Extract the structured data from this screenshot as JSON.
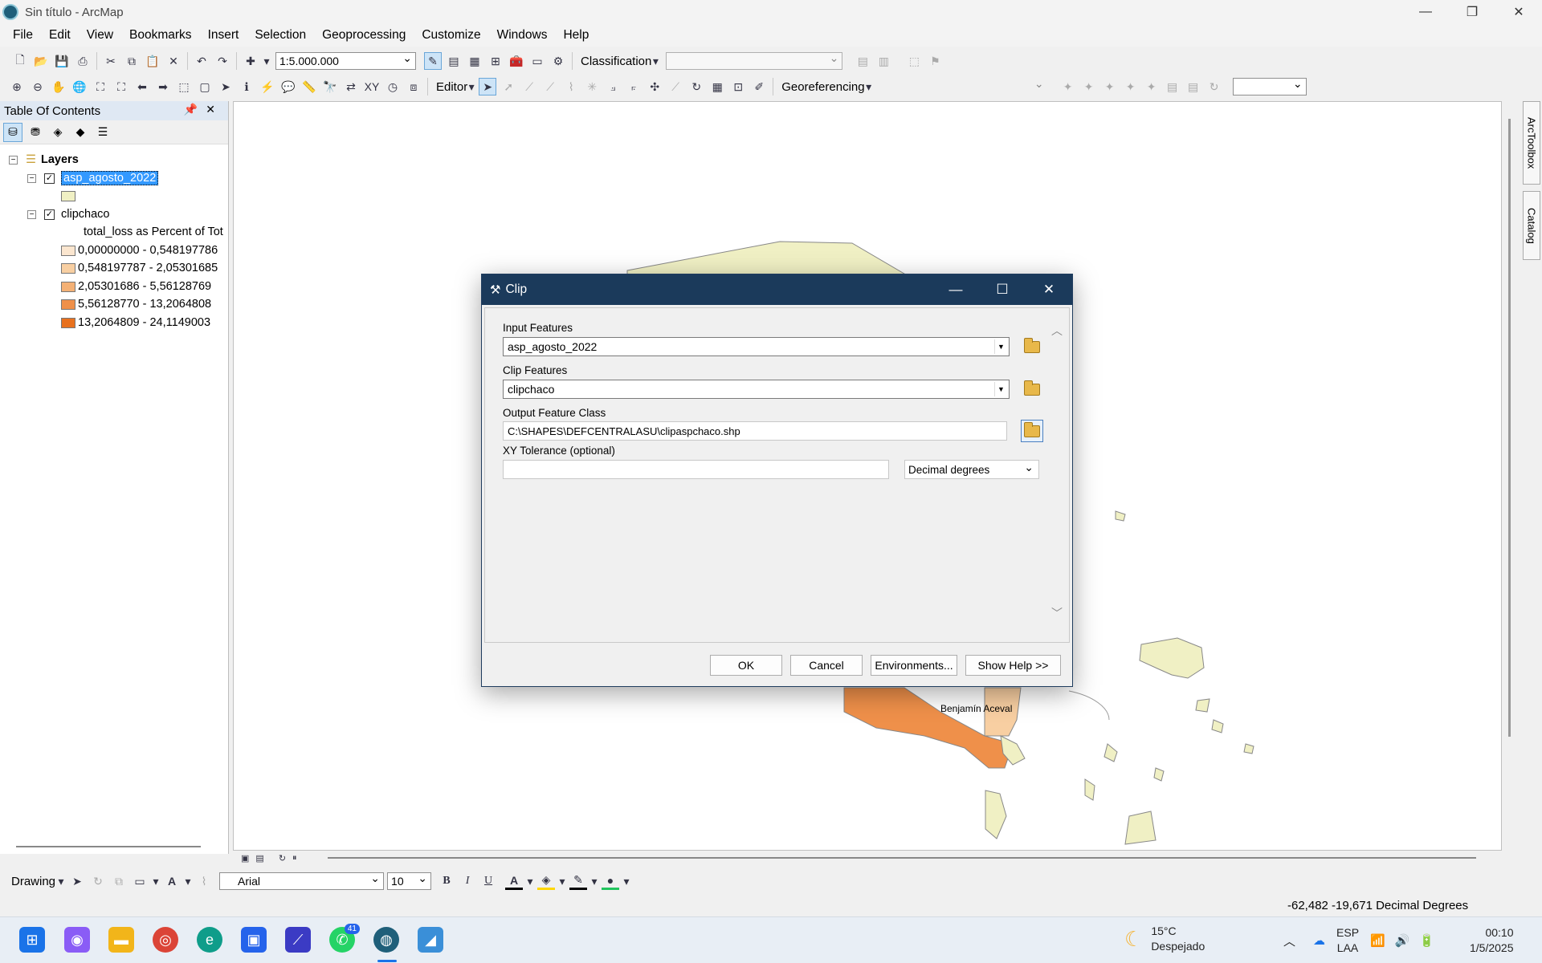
{
  "window": {
    "title": "Sin título - ArcMap"
  },
  "menu": [
    "File",
    "Edit",
    "View",
    "Bookmarks",
    "Insert",
    "Selection",
    "Geoprocessing",
    "Customize",
    "Windows",
    "Help"
  ],
  "toolbar": {
    "scale": "1:5.000.000",
    "classification": "Classification",
    "editor": "Editor",
    "georeferencing": "Georeferencing"
  },
  "toc": {
    "title": "Table Of Contents",
    "root": "Layers",
    "layer1": "asp_agosto_2022",
    "layer2": "clipchaco",
    "field": "total_loss as Percent of Tot",
    "classes": [
      {
        "label": "0,00000000 - 0,548197786",
        "color": "#fbe6cf"
      },
      {
        "label": "0,548197787 - 2,05301685",
        "color": "#f8cfa2"
      },
      {
        "label": "2,05301686 - 5,56128769",
        "color": "#f4b176"
      },
      {
        "label": "5,56128770 - 13,2064808",
        "color": "#ef904a"
      },
      {
        "label": "13,2064809 - 24,1149003",
        "color": "#e8711e"
      }
    ],
    "layer1_color": "#f0f0c4"
  },
  "map": {
    "place_label": "Benjamín Aceval"
  },
  "dialog": {
    "title": "Clip",
    "input_label": "Input Features",
    "input_value": "asp_agosto_2022",
    "clip_label": "Clip Features",
    "clip_value": "clipchaco",
    "output_label": "Output Feature Class",
    "output_value": "C:\\SHAPES\\DEFCENTRALASU\\clipaspchaco.shp",
    "tol_label": "XY Tolerance (optional)",
    "tol_units": "Decimal degrees",
    "ok": "OK",
    "cancel": "Cancel",
    "environments": "Environments...",
    "show_help": "Show Help >>"
  },
  "drawing": {
    "label": "Drawing",
    "font": "Arial",
    "size": "10"
  },
  "status": {
    "coords": "-62,482  -19,671 Decimal Degrees"
  },
  "rdock": {
    "arctoolbox": "ArcToolbox",
    "catalog": "Catalog"
  },
  "taskbar": {
    "whatsapp_badge": "41",
    "temp": "15°C",
    "weather": "Despejado",
    "lang1": "ESP",
    "lang2": "LAA",
    "time": "00:10",
    "date": "1/5/2025"
  }
}
